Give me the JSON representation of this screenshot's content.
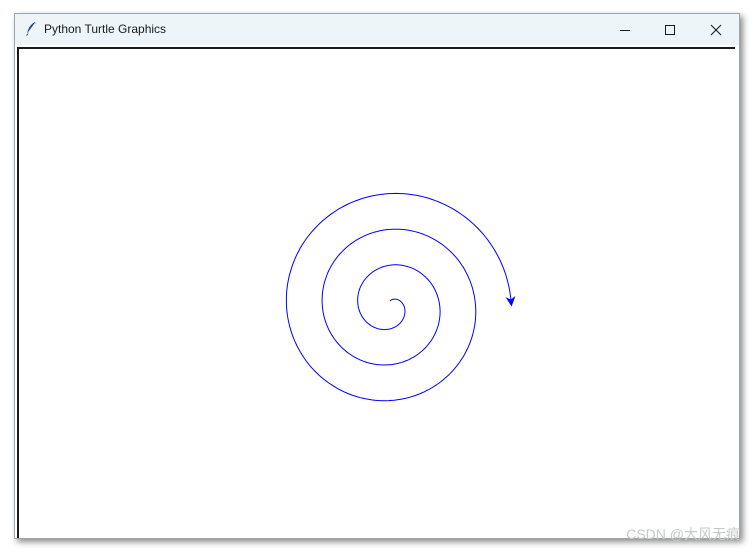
{
  "window": {
    "title": "Python Turtle Graphics",
    "icon": "feather-icon",
    "controls": {
      "minimize_icon": "minimize-icon",
      "maximize_icon": "maximize-icon",
      "close_icon": "close-icon"
    }
  },
  "canvas": {
    "pen_color": "#0000ff",
    "turtle_color": "#0000ff",
    "turtle_shape": "classic-arrow",
    "drawing": "spiral",
    "spiral_turns": 3
  },
  "watermark": "CSDN @大风无痕"
}
